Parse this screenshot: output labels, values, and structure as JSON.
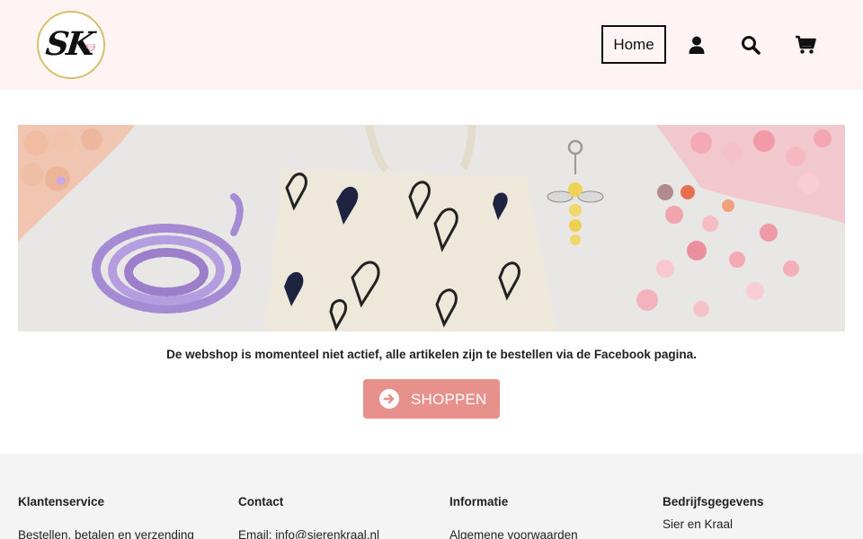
{
  "header": {
    "logo_text": "SK",
    "nav": {
      "home_label": "Home"
    },
    "icons": [
      "user-icon",
      "search-icon",
      "cart-icon"
    ]
  },
  "banner": {
    "alt": ""
  },
  "main": {
    "notice": "De webshop is momenteel niet actief, alle artikelen zijn te bestellen via de Facebook pagina.",
    "shop_button_label": "SHOPPEN"
  },
  "footer": {
    "columns": [
      {
        "title": "Klantenservice",
        "lines": [
          "Bestellen, betalen en verzending"
        ]
      },
      {
        "title": "Contact",
        "lines": [
          "Email: info@sierenkraal.nl"
        ]
      },
      {
        "title": "Informatie",
        "lines": [
          "Algemene voorwaarden"
        ]
      },
      {
        "title": "Bedrijfsgegevens",
        "lines": [
          "Sier en Kraal"
        ]
      }
    ]
  },
  "colors": {
    "header_bg": "#fdf4f3",
    "button_bg": "#e8908c",
    "footer_bg": "#f4f4f4",
    "logo_ring": "#d9bf6a"
  }
}
